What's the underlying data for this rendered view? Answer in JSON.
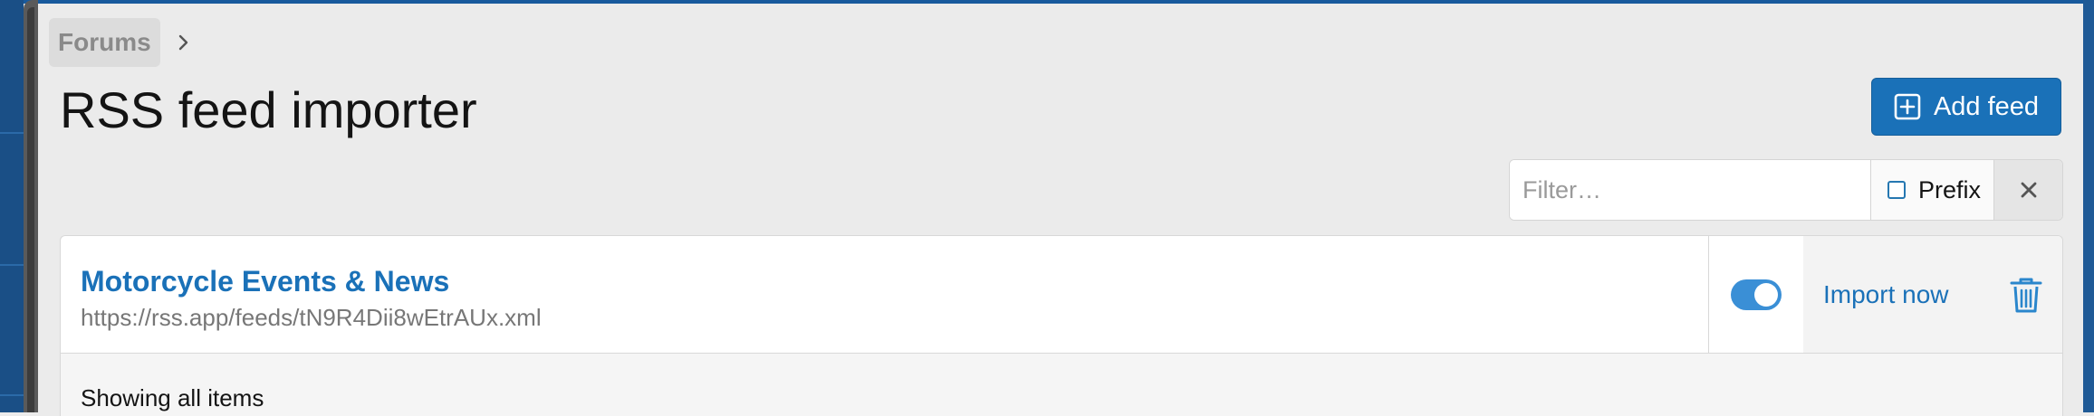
{
  "breadcrumb": {
    "items": [
      "Forums"
    ]
  },
  "page": {
    "title": "RSS feed importer"
  },
  "toolbar": {
    "add_feed_label": "Add feed",
    "add_feed_icon": "plus-square-icon"
  },
  "filter": {
    "placeholder": "Filter…",
    "value": "",
    "prefix_label": "Prefix",
    "prefix_checked": false,
    "clear_icon": "close-icon"
  },
  "feeds": [
    {
      "title": "Motorcycle Events & News",
      "url": "https://rss.app/feeds/tN9R4Dii8wEtrAUx.xml",
      "enabled": true,
      "import_label": "Import now",
      "delete_icon": "trash-icon"
    }
  ],
  "footer": {
    "status": "Showing all items"
  },
  "colors": {
    "accent": "#1a71b8",
    "toggle_on": "#3a8fd6",
    "background": "#ebebeb"
  }
}
